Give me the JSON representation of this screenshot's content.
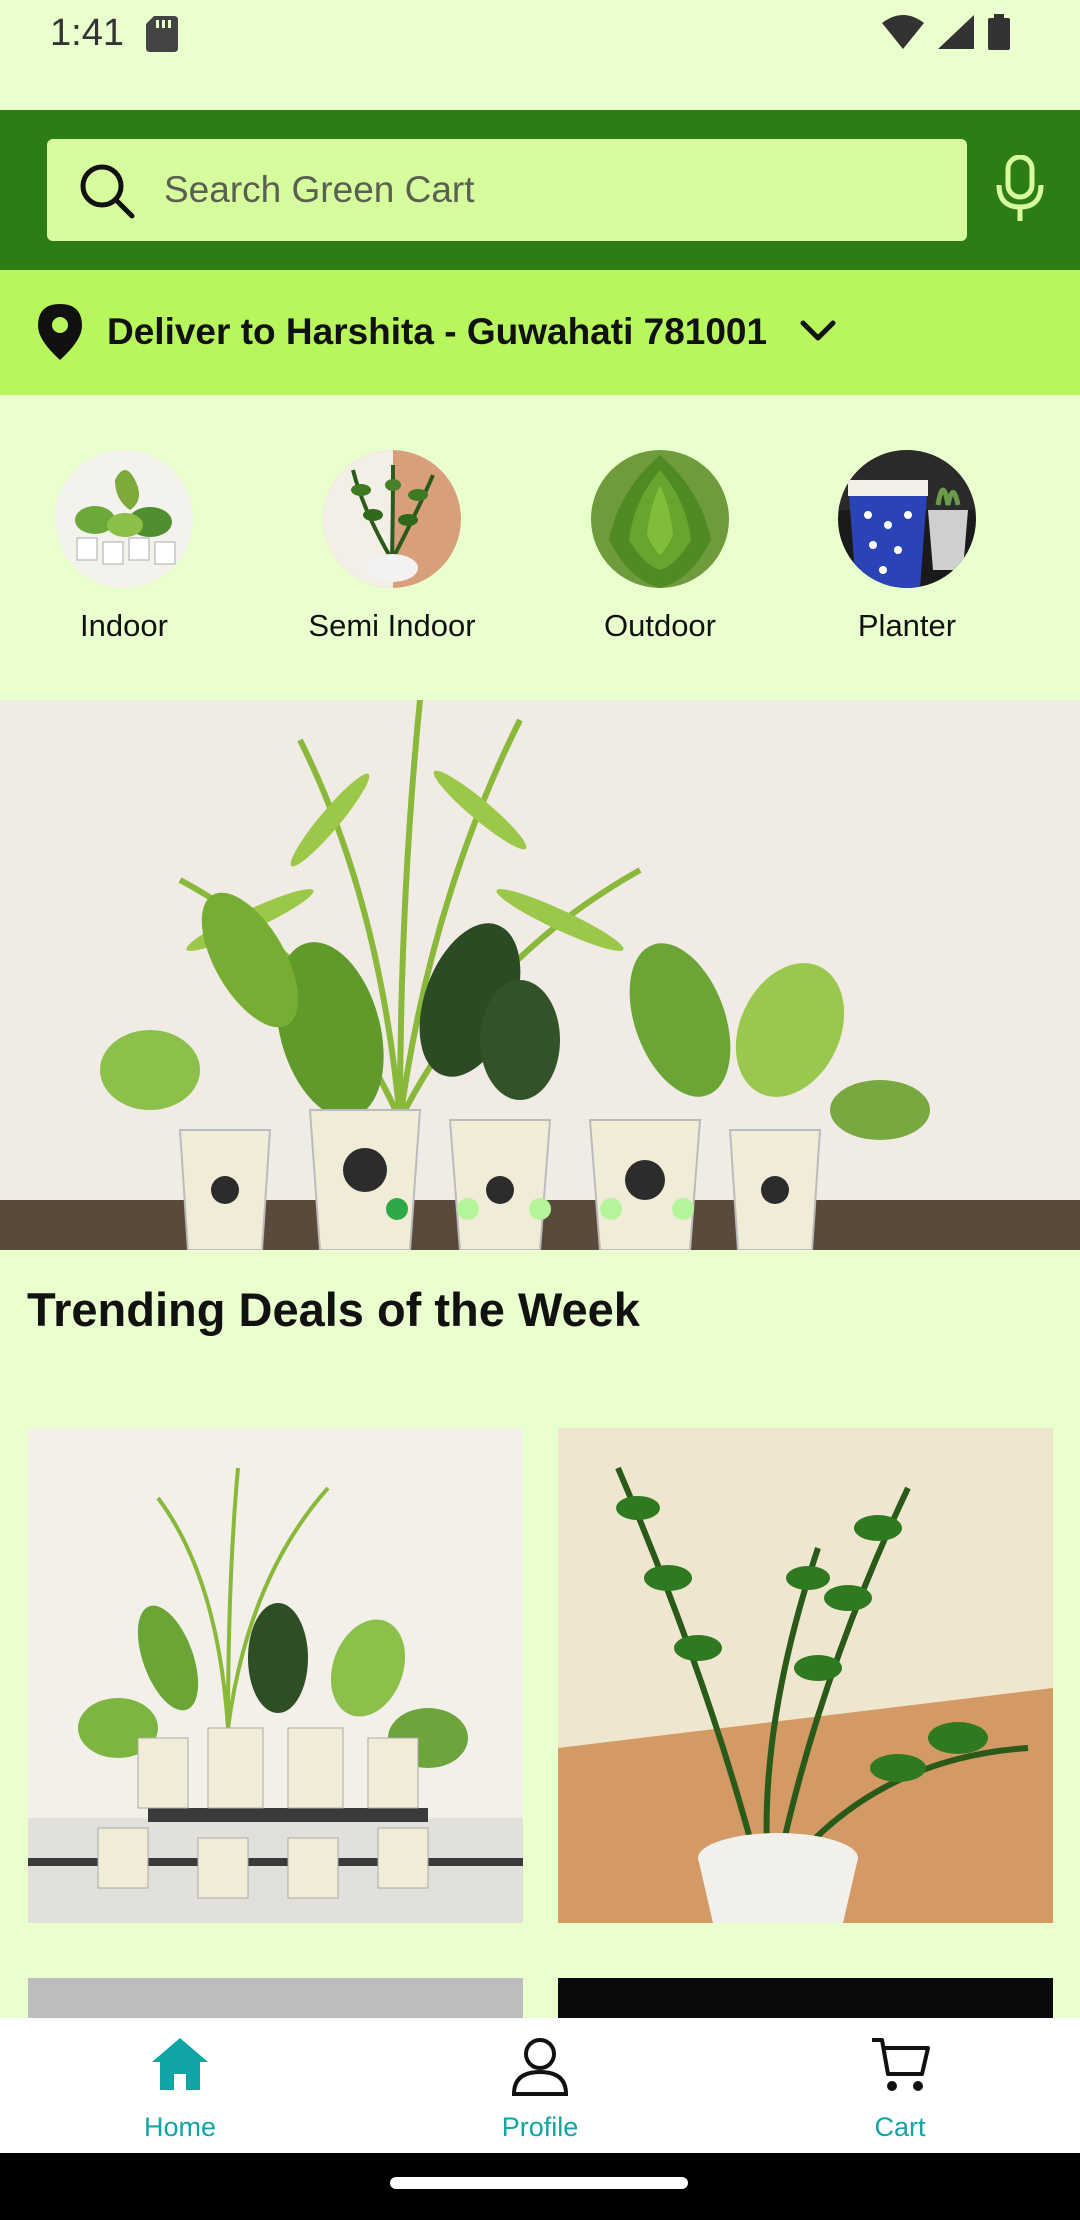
{
  "status_bar": {
    "time": "1:41"
  },
  "search": {
    "placeholder": "Search Green Cart"
  },
  "delivery": {
    "text": "Deliver to Harshita - Guwahati 781001"
  },
  "categories": [
    {
      "label": "Indoor"
    },
    {
      "label": "Semi Indoor"
    },
    {
      "label": "Outdoor"
    },
    {
      "label": "Planter"
    }
  ],
  "banner": {
    "slide_count": 5,
    "active_slide": 1
  },
  "trending": {
    "title": "Trending Deals of the Week"
  },
  "bottom_nav": {
    "home": "Home",
    "profile": "Profile",
    "cart": "Cart"
  },
  "colors": {
    "background": "#eaffce",
    "header_green": "#2e7d14",
    "search_fill": "#d6fc9e",
    "delivery_bar": "#b7f75d",
    "nav_accent": "#11a4a4",
    "dot_active": "#2fa84a",
    "dot_inactive": "#b5f59a"
  }
}
